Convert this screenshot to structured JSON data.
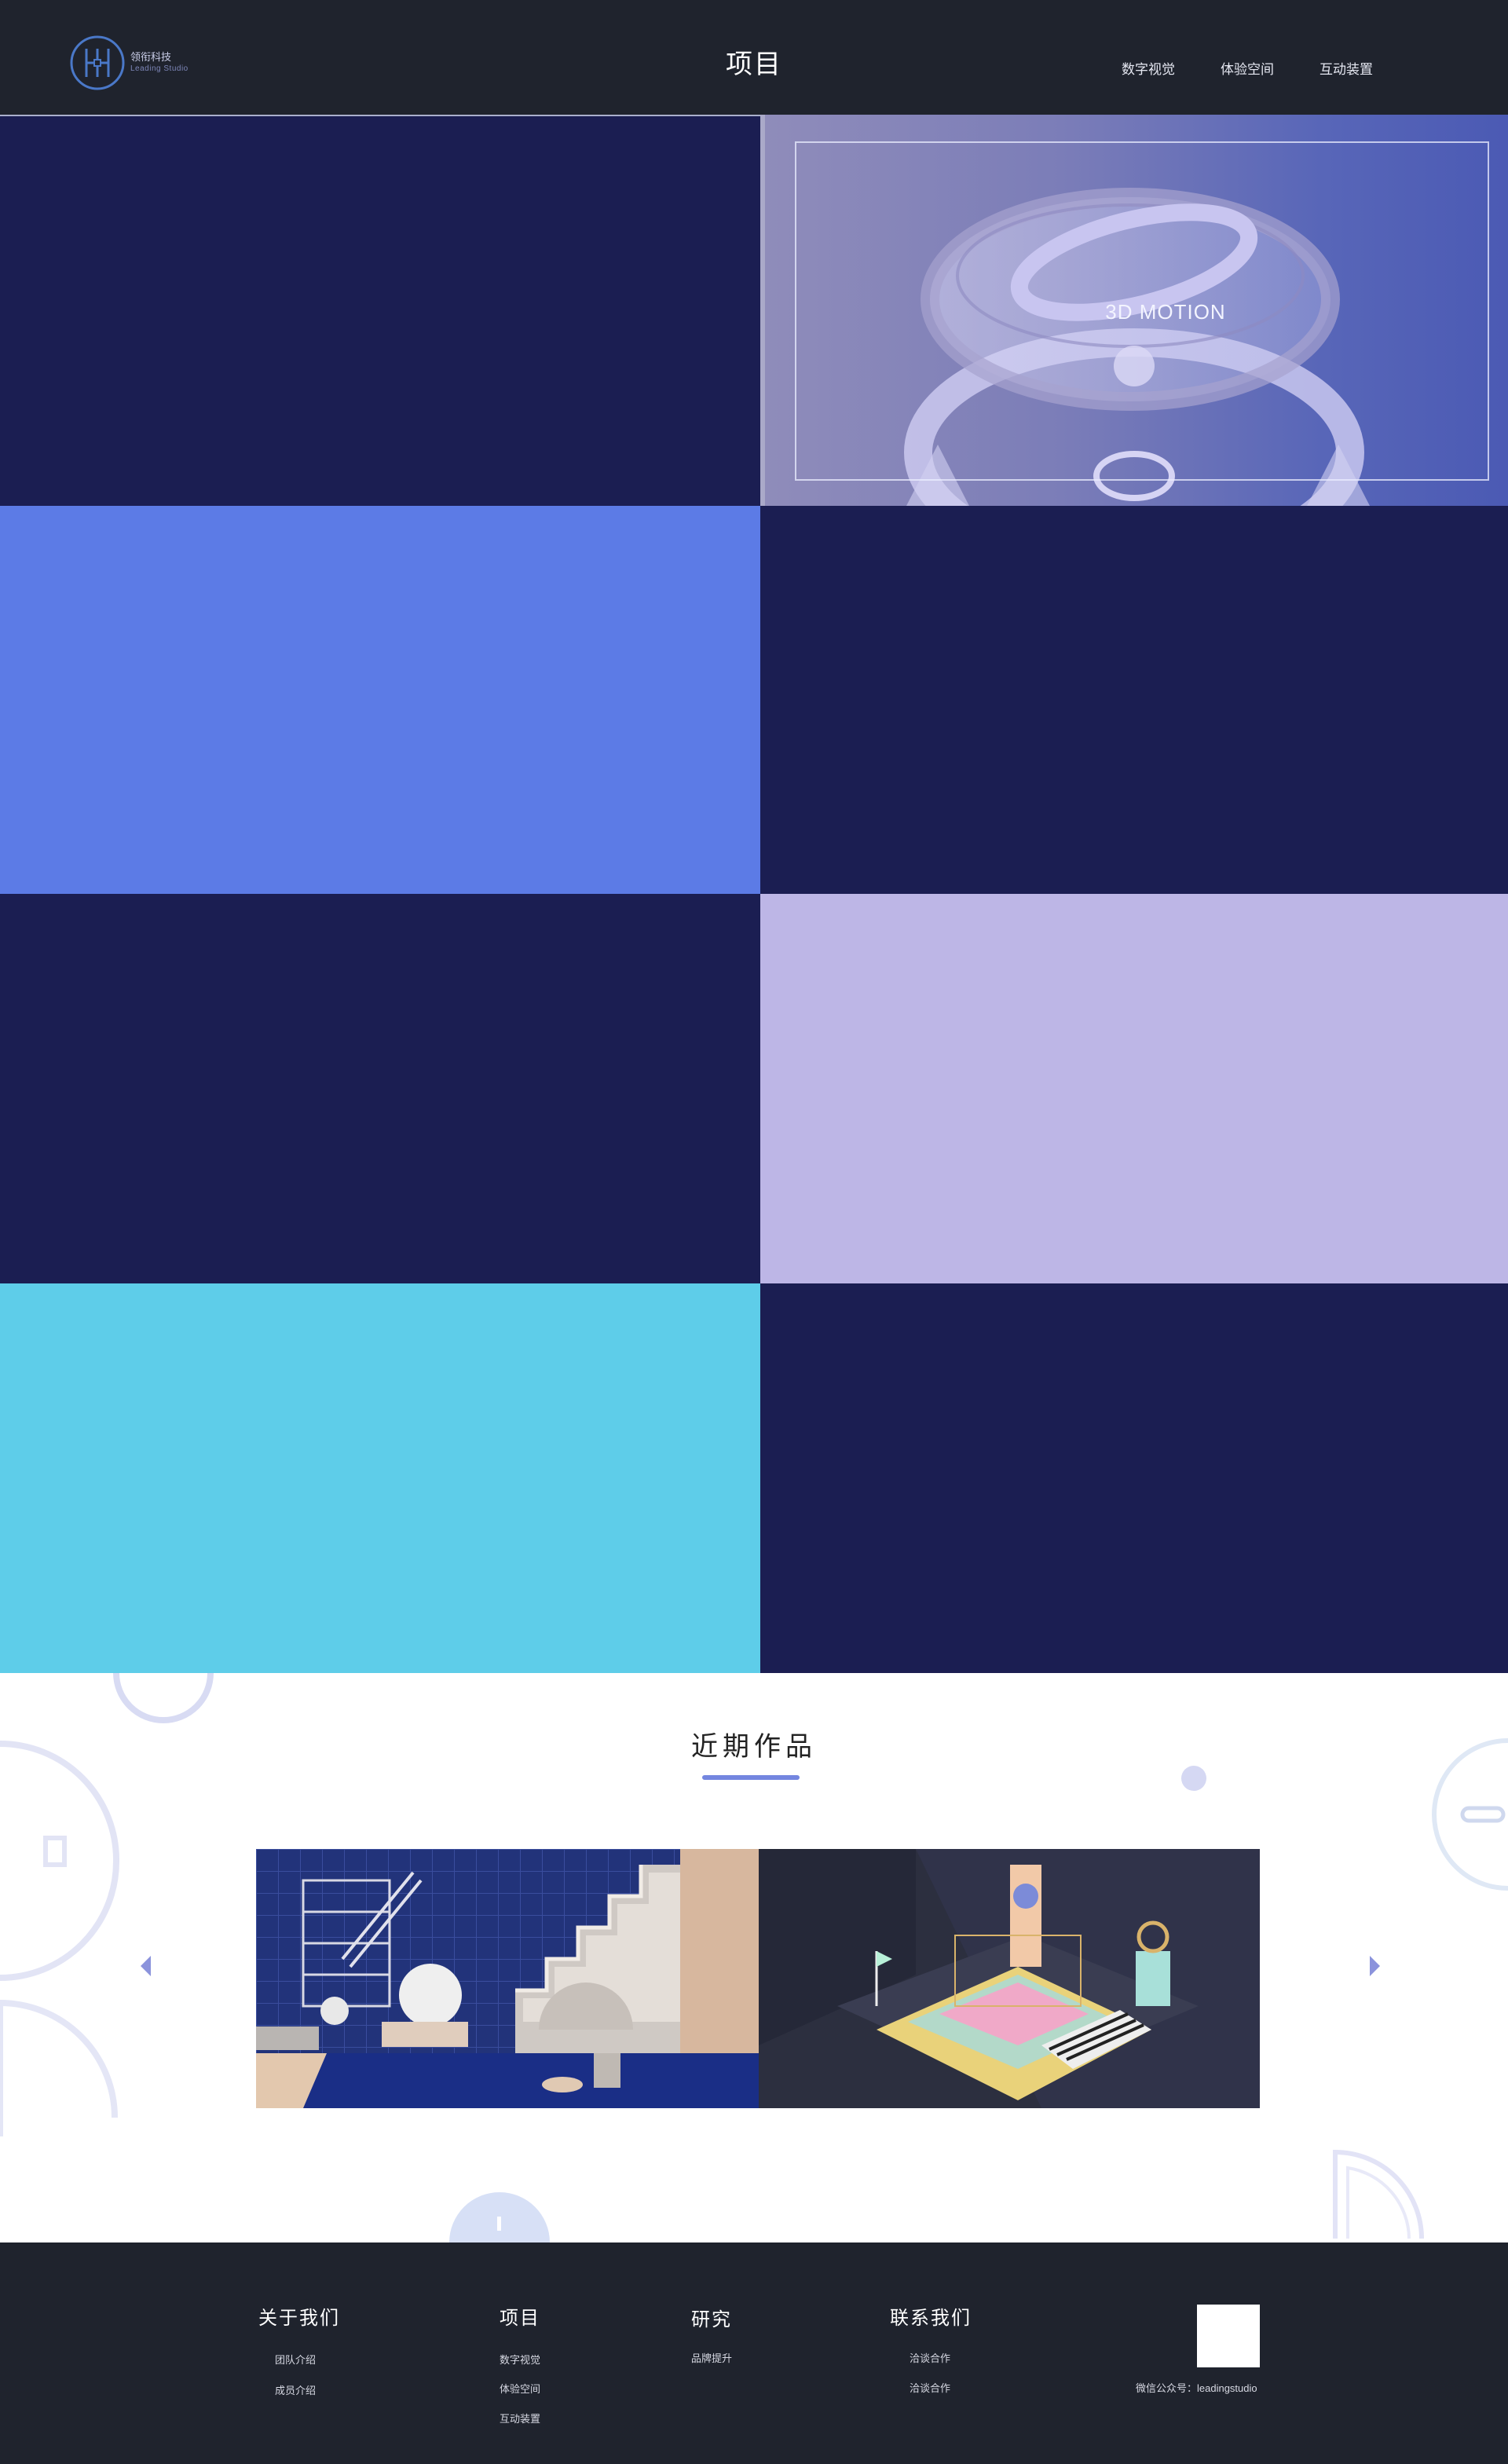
{
  "header": {
    "logo_cn": "领衔科技",
    "logo_en": "Leading Studio",
    "title": "项目",
    "nav": [
      {
        "label": "数字视觉"
      },
      {
        "label": "体验空间"
      },
      {
        "label": "互动装置"
      }
    ]
  },
  "projects": {
    "featured_label": "3D MOTION",
    "colors": {
      "navy": "#1b1e52",
      "blue": "#5c7be6",
      "lavender": "#bdb6e6",
      "cyan": "#5ecde9"
    }
  },
  "recent": {
    "title": "近期作品",
    "accent": "#7486e0"
  },
  "footer": {
    "columns": [
      {
        "heading": "关于我们",
        "links": [
          "团队介绍",
          "成员介绍"
        ]
      },
      {
        "heading": "项目",
        "links": [
          "数字视觉",
          "体验空间",
          "互动装置"
        ]
      },
      {
        "heading": "研究",
        "links": [
          "品牌提升"
        ]
      },
      {
        "heading": "联系我们",
        "links": [
          "洽谈合作",
          "洽谈合作"
        ]
      }
    ],
    "wechat": "微信公众号：leadingstudio"
  }
}
